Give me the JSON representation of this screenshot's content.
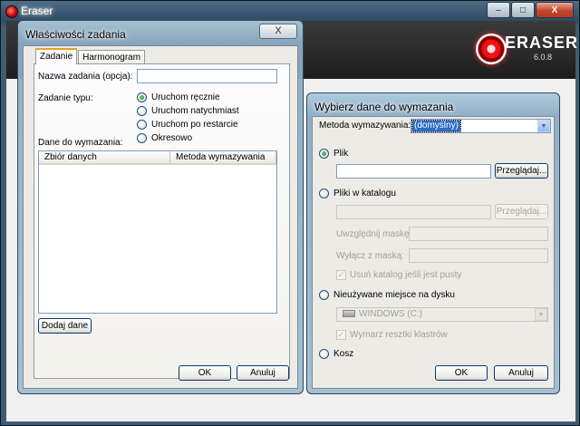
{
  "app": {
    "title": "Eraser",
    "brand_name": "ERASER",
    "brand_version": "6.0.8",
    "window_buttons": {
      "minimize": "–",
      "maximize": "□",
      "close": "X"
    }
  },
  "props_dialog": {
    "title": "Właściwości zadania",
    "close": "X",
    "tabs": [
      {
        "label": "Zadanie",
        "active": true
      },
      {
        "label": "Harmonogram",
        "active": false
      }
    ],
    "task_name_label": "Nazwa zadania (opcja):",
    "task_name_value": "",
    "task_type_label": "Zadanie typu:",
    "task_types": [
      {
        "label": "Uruchom ręcznie",
        "selected": true
      },
      {
        "label": "Uruchom natychmiast",
        "selected": false
      },
      {
        "label": "Uruchom po restarcie",
        "selected": false
      },
      {
        "label": "Okresowo",
        "selected": false
      }
    ],
    "data_label": "Dane do wymazania:",
    "columns": [
      "Zbiór danych",
      "Metoda wymazywania"
    ],
    "add_button": "Dodaj dane",
    "ok": "OK",
    "cancel": "Anuluj"
  },
  "select_dialog": {
    "title": "Wybierz dane do wymazania",
    "method_label": "Metoda wymazywania:",
    "method_value": "(domyślny)",
    "options": {
      "file": {
        "label": "Plik",
        "selected": true,
        "value": "",
        "browse": "Przeglądaj..."
      },
      "folder": {
        "label": "Pliki w katalogu",
        "selected": false,
        "value": "",
        "browse": "Przeglądaj...",
        "include_mask_label": "Uwzględnij maskę:",
        "exclude_mask_label": "Wyłącz z maską:",
        "delete_empty_label": "Usuń katalog jeśli jest pusty",
        "delete_empty_checked": true
      },
      "unused": {
        "label": "Nieużywane miejsce na dysku",
        "selected": false,
        "drive_value": "WINDOWS (C:)",
        "cluster_tips_label": "Wymarz resztki klastrów",
        "cluster_tips_checked": true
      },
      "recycle": {
        "label": "Kosz",
        "selected": false
      }
    },
    "ok": "OK",
    "cancel": "Anuluj"
  }
}
